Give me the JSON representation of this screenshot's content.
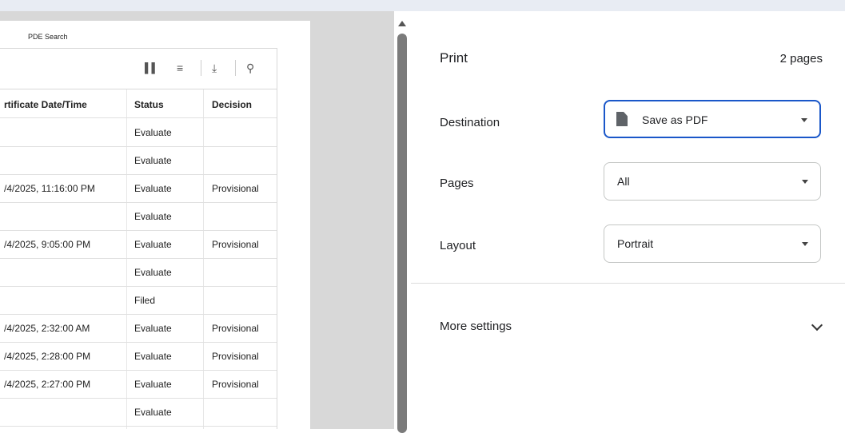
{
  "preview": {
    "page_title": "PDE Search",
    "columns": [
      "rtificate Date/Time",
      "Status",
      "Decision"
    ],
    "rows": [
      [
        "",
        "Evaluate",
        ""
      ],
      [
        "",
        "Evaluate",
        ""
      ],
      [
        "/4/2025, 11:16:00 PM",
        "Evaluate",
        "Provisional"
      ],
      [
        "",
        "Evaluate",
        ""
      ],
      [
        "/4/2025, 9:05:00 PM",
        "Evaluate",
        "Provisional"
      ],
      [
        "",
        "Evaluate",
        ""
      ],
      [
        "",
        "Filed",
        ""
      ],
      [
        "/4/2025, 2:32:00 AM",
        "Evaluate",
        "Provisional"
      ],
      [
        "/4/2025, 2:28:00 PM",
        "Evaluate",
        "Provisional"
      ],
      [
        "/4/2025, 2:27:00 PM",
        "Evaluate",
        "Provisional"
      ],
      [
        "",
        "Evaluate",
        ""
      ]
    ],
    "toolbar_icons": [
      "columns-icon",
      "filter-icon",
      "download-icon",
      "search-icon"
    ]
  },
  "panel": {
    "title": "Print",
    "pages_count": "2 pages",
    "destination": {
      "label": "Destination",
      "value": "Save as PDF",
      "icon": "document-icon"
    },
    "pages": {
      "label": "Pages",
      "value": "All"
    },
    "layout": {
      "label": "Layout",
      "value": "Portrait"
    },
    "more_settings": "More settings"
  },
  "colors": {
    "accent": "#1a57c9",
    "preview_bg": "#d8d8d8"
  }
}
